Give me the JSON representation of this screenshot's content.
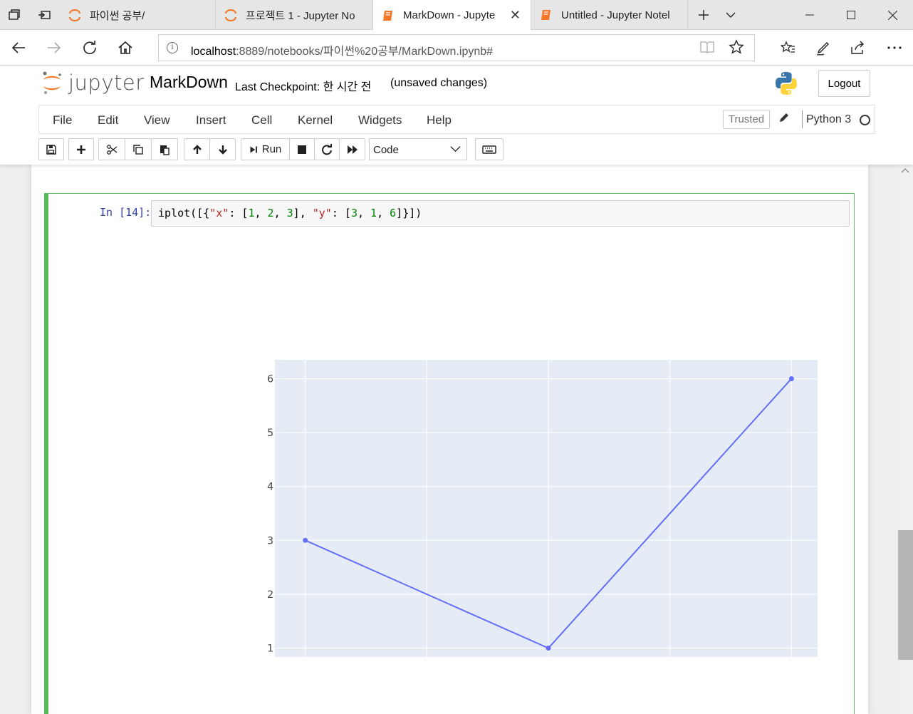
{
  "browser": {
    "tabs": [
      {
        "label": "파이썬 공부/",
        "icon": "jupyter-icon",
        "active": false
      },
      {
        "label": "프로젝트 1 - Jupyter No",
        "icon": "jupyter-icon",
        "active": false
      },
      {
        "label": "MarkDown - Jupyte",
        "icon": "notebook-icon",
        "active": true
      },
      {
        "label": "Untitled - Jupyter Notel",
        "icon": "notebook-icon",
        "active": false
      }
    ],
    "address": {
      "host": "localhost",
      "path": ":8889/notebooks/파이썬%20공부/MarkDown.ipynb#"
    }
  },
  "jupyter": {
    "logo_text": "jupyter",
    "notebook_name": "MarkDown",
    "checkpoint": "Last Checkpoint: 한 시간 전",
    "status": "(unsaved changes)",
    "logout_label": "Logout",
    "menu": [
      "File",
      "Edit",
      "View",
      "Insert",
      "Cell",
      "Kernel",
      "Widgets",
      "Help"
    ],
    "trusted_label": "Trusted",
    "kernel_name": "Python 3",
    "toolbar": {
      "run_label": "Run",
      "cell_type": "Code"
    }
  },
  "cell": {
    "prompt": "In [14]:",
    "code": "iplot([{\"x\": [1, 2, 3], \"y\": [3, 1, 6]}])"
  },
  "chart_data": {
    "type": "line",
    "x": [
      1,
      2,
      3
    ],
    "series": [
      {
        "values": [
          3,
          1,
          6
        ],
        "color": "#636efa"
      }
    ],
    "xlim": [
      0.875,
      3.125
    ],
    "ylim": [
      0.65,
      6.35
    ],
    "xticks": [
      "1",
      "1.5",
      "2",
      "2.5",
      "3"
    ],
    "yticks": [
      "1",
      "2",
      "3",
      "4",
      "5",
      "6"
    ],
    "plot_bgcolor": "#e5ecf6",
    "grid": true,
    "title": "",
    "xlabel": "",
    "ylabel": ""
  }
}
